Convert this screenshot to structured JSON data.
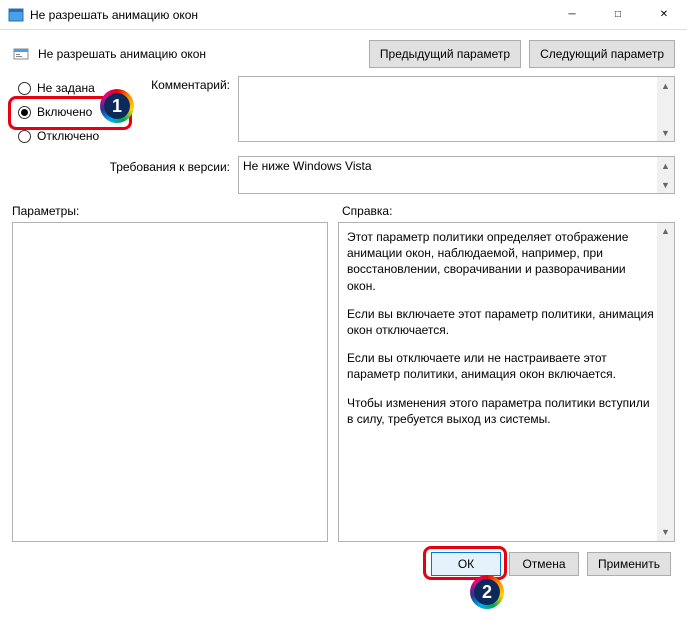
{
  "window": {
    "title": "Не разрешать анимацию окон"
  },
  "header": {
    "setting_name": "Не разрешать анимацию окон",
    "prev_btn": "Предыдущий параметр",
    "next_btn": "Следующий параметр"
  },
  "states": {
    "not_configured": "Не задана",
    "enabled": "Включено",
    "disabled": "Отключено",
    "selected": "enabled"
  },
  "comment": {
    "label": "Комментарий:",
    "value": ""
  },
  "requirements": {
    "label": "Требования к версии:",
    "value": "Не ниже Windows Vista"
  },
  "panels": {
    "options_label": "Параметры:",
    "help_label": "Справка:"
  },
  "help": {
    "p1": "Этот параметр политики определяет отображение анимации окон, наблюдаемой, например, при восстановлении, сворачивании и разворачивании окон.",
    "p2": "Если вы включаете этот параметр политики, анимация окон отключается.",
    "p3": "Если вы отключаете или не настраиваете этот параметр политики, анимация окон включается.",
    "p4": "Чтобы изменения этого параметра политики вступили в силу, требуется выход из системы."
  },
  "footer": {
    "ok": "ОК",
    "cancel": "Отмена",
    "apply": "Применить"
  },
  "annotations": {
    "badge1": "1",
    "badge2": "2"
  }
}
